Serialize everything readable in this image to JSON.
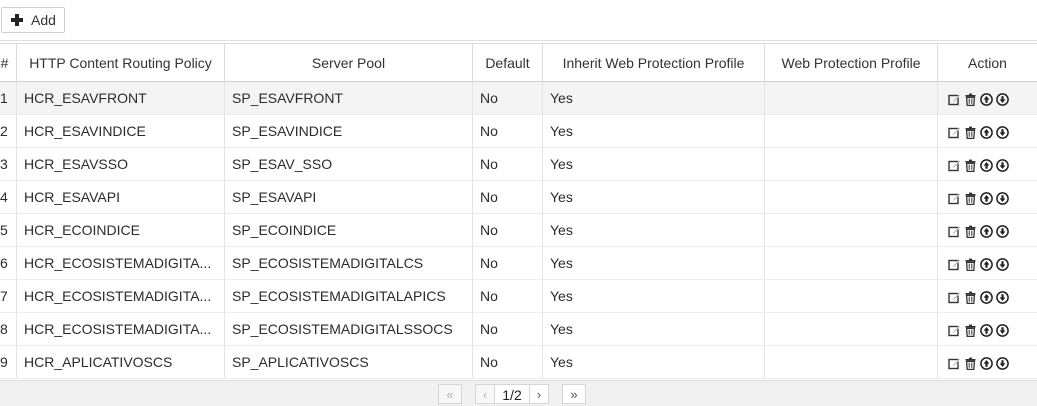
{
  "toolbar": {
    "add_label": "Add"
  },
  "columns": {
    "num": "#",
    "policy": "HTTP Content Routing Policy",
    "pool": "Server Pool",
    "default": "Default",
    "inherit": "Inherit Web Protection Profile",
    "profile": "Web Protection Profile",
    "action": "Action"
  },
  "rows": [
    {
      "num": "1",
      "policy": "HCR_ESAVFRONT",
      "pool": "SP_ESAVFRONT",
      "default": "No",
      "inherit": "Yes",
      "profile": ""
    },
    {
      "num": "2",
      "policy": "HCR_ESAVINDICE",
      "pool": "SP_ESAVINDICE",
      "default": "No",
      "inherit": "Yes",
      "profile": ""
    },
    {
      "num": "3",
      "policy": "HCR_ESAVSSO",
      "pool": "SP_ESAV_SSO",
      "default": "No",
      "inherit": "Yes",
      "profile": ""
    },
    {
      "num": "4",
      "policy": "HCR_ESAVAPI",
      "pool": "SP_ESAVAPI",
      "default": "No",
      "inherit": "Yes",
      "profile": ""
    },
    {
      "num": "5",
      "policy": "HCR_ECOINDICE",
      "pool": "SP_ECOINDICE",
      "default": "No",
      "inherit": "Yes",
      "profile": ""
    },
    {
      "num": "6",
      "policy": "HCR_ECOSISTEMADIGITA...",
      "pool": "SP_ECOSISTEMADIGITALCS",
      "default": "No",
      "inherit": "Yes",
      "profile": ""
    },
    {
      "num": "7",
      "policy": "HCR_ECOSISTEMADIGITA...",
      "pool": "SP_ECOSISTEMADIGITALAPICS",
      "default": "No",
      "inherit": "Yes",
      "profile": ""
    },
    {
      "num": "8",
      "policy": "HCR_ECOSISTEMADIGITA...",
      "pool": "SP_ECOSISTEMADIGITALSSOCS",
      "default": "No",
      "inherit": "Yes",
      "profile": ""
    },
    {
      "num": "9",
      "policy": "HCR_APLICATIVOSCS",
      "pool": "SP_APLICATIVOSCS",
      "default": "No",
      "inherit": "Yes",
      "profile": ""
    }
  ],
  "row_actions": [
    "edit-icon",
    "delete-icon",
    "move-up-icon",
    "move-down-icon"
  ],
  "pager": {
    "first": "«",
    "prev": "‹",
    "page": "1/2",
    "next": "›",
    "last": "»"
  },
  "colors": {
    "selected_row": "#f4f4f4",
    "border": "#dcdcdc",
    "pager_bg": "#f1f1f1"
  }
}
